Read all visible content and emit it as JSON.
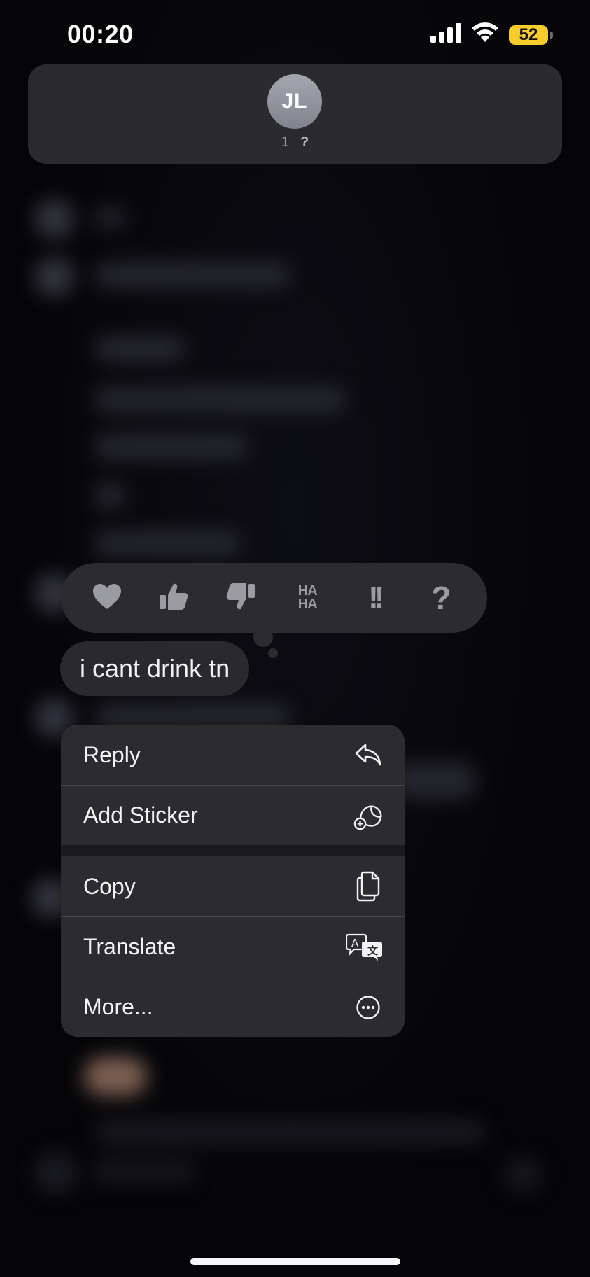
{
  "status_bar": {
    "time": "00:20",
    "battery_level": "52",
    "signal_icon": "cellular-signal-icon",
    "wifi_icon": "wifi-icon"
  },
  "header": {
    "avatar_initials": "JL",
    "subtitle_count": "1",
    "subtitle_mark": "?"
  },
  "tapbacks": [
    {
      "name": "heart",
      "icon": "heart-icon"
    },
    {
      "name": "thumbs-up",
      "icon": "thumbs-up-icon"
    },
    {
      "name": "thumbs-down",
      "icon": "thumbs-down-icon"
    },
    {
      "name": "haha",
      "label_top": "HA",
      "label_bottom": "HA"
    },
    {
      "name": "emphasize",
      "label": "!!"
    },
    {
      "name": "question",
      "label": "?"
    }
  ],
  "message": {
    "text": "i cant drink tn"
  },
  "menu": {
    "group1": [
      {
        "label": "Reply",
        "icon": "reply-arrow-icon"
      },
      {
        "label": "Add Sticker",
        "icon": "add-sticker-icon"
      }
    ],
    "group2": [
      {
        "label": "Copy",
        "icon": "copy-icon"
      },
      {
        "label": "Translate",
        "icon": "translate-icon"
      },
      {
        "label": "More...",
        "icon": "ellipsis-circle-icon"
      }
    ]
  },
  "colors": {
    "background": "#07070b",
    "card": "#2b2b2f",
    "battery": "#f6cd2a",
    "icon_gray": "#9b9ba2"
  }
}
